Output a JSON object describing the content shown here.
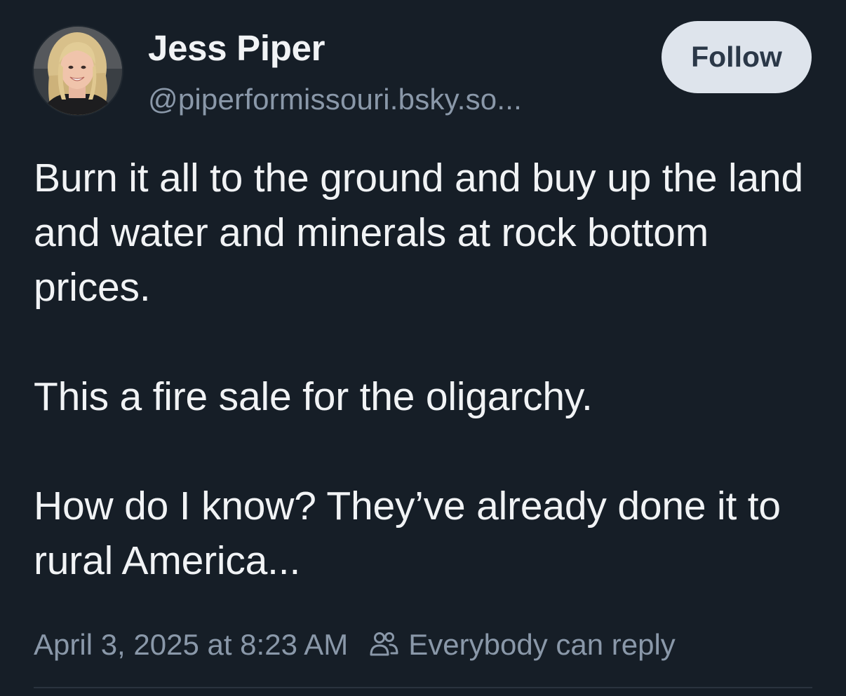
{
  "post": {
    "author": {
      "display_name": "Jess Piper",
      "handle": "@piperformissouri.bsky.so..."
    },
    "follow_label": "Follow",
    "text": "Burn it all to the ground and buy up the land and water and minerals at rock bottom prices.\n\nThis a fire sale for the oligarchy.\n\nHow do I know? They’ve already done it to rural America...",
    "timestamp": "April 3, 2025 at 8:23 AM",
    "reply_setting": "Everybody can reply",
    "reply_icon": "people-icon"
  },
  "colors": {
    "background": "#161e27",
    "primary_text": "#f1f3f5",
    "secondary_text": "#8a98a9",
    "follow_button_bg": "#dee4ec",
    "follow_button_text": "#2b3848"
  }
}
